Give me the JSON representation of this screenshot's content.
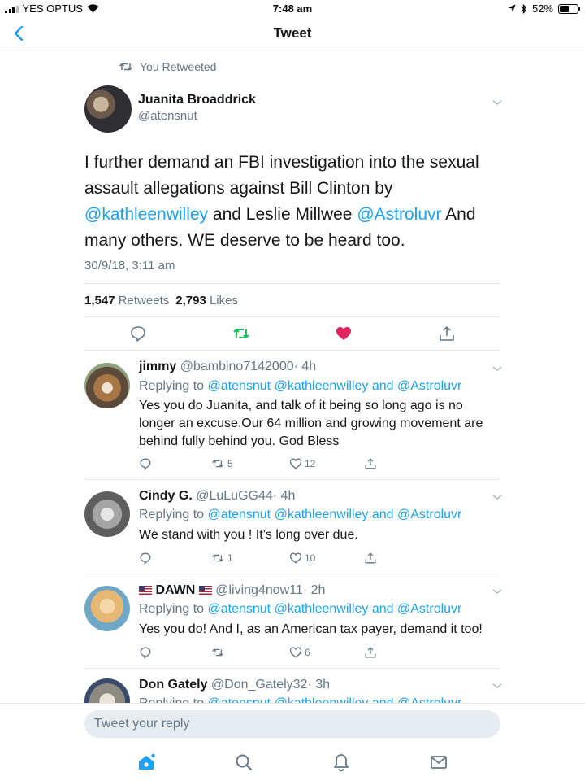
{
  "status_bar": {
    "carrier": "YES OPTUS",
    "time": "7:48 am",
    "battery": "52%",
    "battery_level": 0.52
  },
  "header": {
    "title": "Tweet"
  },
  "main_tweet": {
    "retweet_label": "You Retweeted",
    "author_name": "Juanita Broaddrick",
    "author_handle": "@atensnut",
    "text_1": "I further demand an FBI investigation into the sexual assault allegations against Bill Clinton by ",
    "mention_1": "@kathleenwilley",
    "text_2": " and Leslie Millwee ",
    "mention_2": "@Astroluvr",
    "text_3": " And many others.  WE deserve to be heard too.",
    "timestamp": "30/9/18, 3:11 am",
    "retweets_count": "1,547",
    "retweets_label": "Retweets",
    "likes_count": "2,793",
    "likes_label": "Likes",
    "liked": true,
    "retweeted": true,
    "colors": {
      "link": "#1da1f2",
      "retweet": "#17bf63",
      "like": "#e0245e",
      "muted": "#657786"
    }
  },
  "replies": [
    {
      "name": "jimmy",
      "handle": "@bambino7142000",
      "age": "· 4h",
      "replying_label": "Replying to",
      "replying_to": "@atensnut @kathleenwilley and @Astroluvr",
      "text": "Yes you do Juanita, and talk of it being so long ago is no longer an excuse.Our 64 million and growing movement are behind fully behind you. God Bless",
      "retweets": "5",
      "likes": "12"
    },
    {
      "name": "Cindy G.",
      "handle": "@LuLuGG44",
      "age": "· 4h",
      "replying_label": "Replying to",
      "replying_to": "@atensnut @kathleenwilley and @Astroluvr",
      "text": "We stand with you ! It’s long over due.",
      "retweets": "1",
      "likes": "10"
    },
    {
      "name": "DAWN",
      "handle": "@living4now11",
      "age": "· 2h",
      "replying_label": "Replying to",
      "replying_to": "@atensnut @kathleenwilley and @Astroluvr",
      "text": "Yes you do! And I, as an American tax payer, demand it too!",
      "retweets": "",
      "likes": "6"
    },
    {
      "name": "Don Gately",
      "handle": "@Don_Gately32",
      "age": "· 3h",
      "replying_label": "Replying to",
      "replying_to": "@atensnut @kathleenwilley and @Astroluvr"
    }
  ],
  "composer": {
    "placeholder": "Tweet your reply"
  },
  "tabs": [
    "home-icon",
    "search-icon",
    "notifications-icon",
    "messages-icon"
  ]
}
